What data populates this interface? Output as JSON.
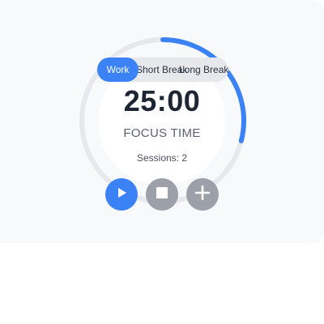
{
  "timer": {
    "time": "25:00",
    "mode_label": "FOCUS TIME",
    "sessions": "Sessions: 2",
    "progress": 0.29
  },
  "tabs": [
    {
      "label": "Work",
      "active": true
    },
    {
      "label": "Short Break",
      "active": false
    },
    {
      "label": "Long Break",
      "active": false
    }
  ],
  "controls": {
    "play_icon": "play-icon",
    "stop_icon": "stop-icon",
    "add_icon": "plus-icon"
  },
  "colors": {
    "accent": "#3b82f6",
    "track": "#e6e8ec",
    "secondary_button": "#9ca0a8",
    "text_dark": "#1e2533"
  }
}
